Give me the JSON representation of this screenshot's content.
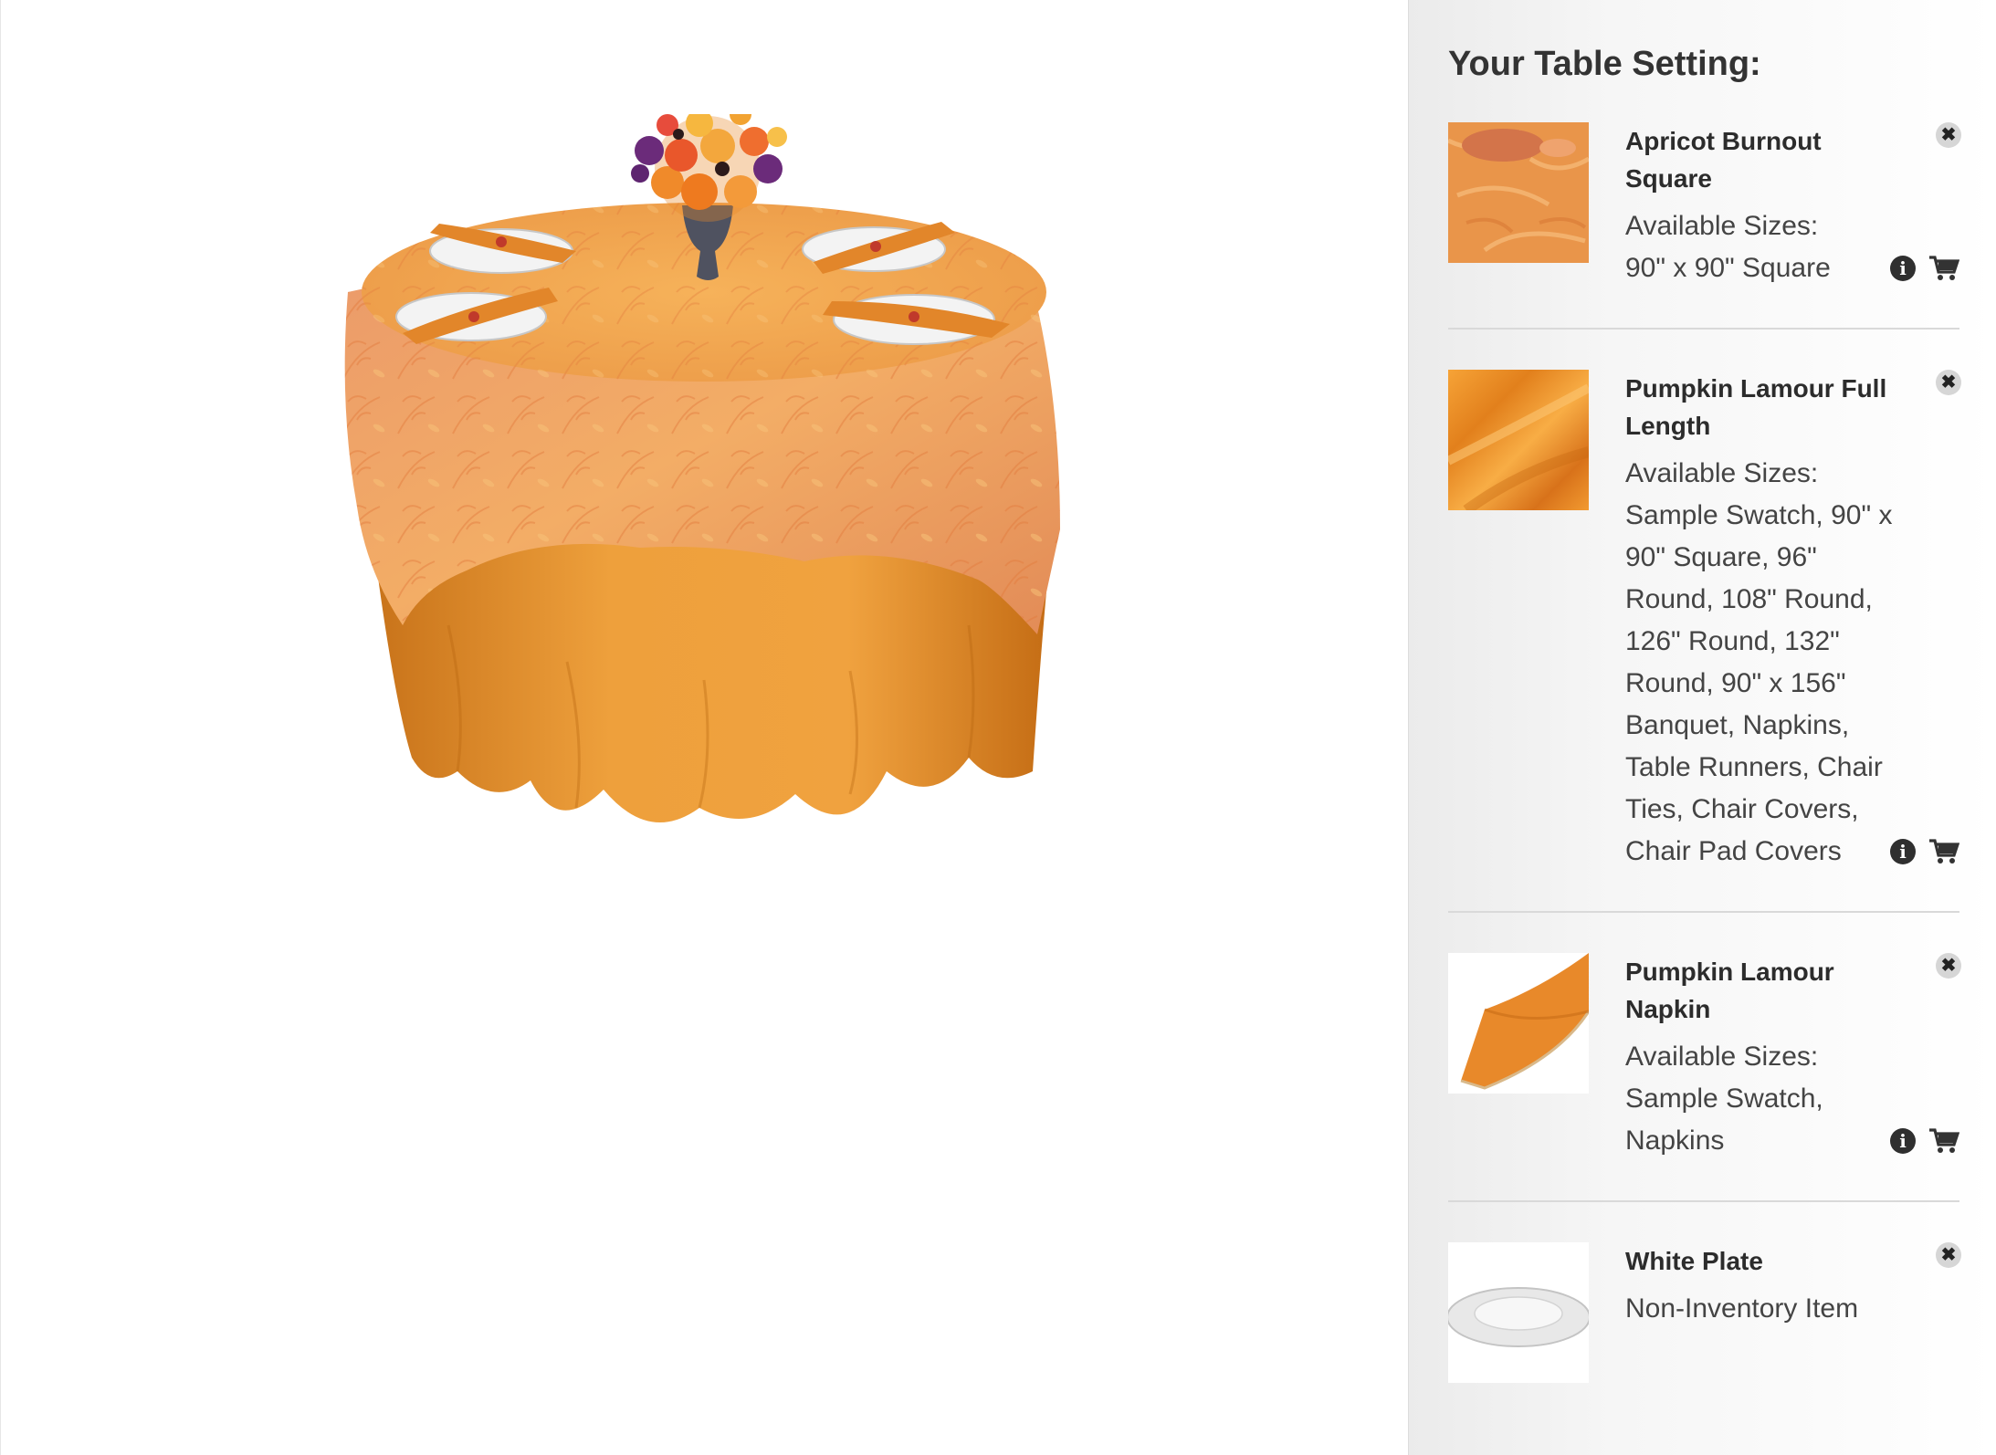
{
  "sidebar": {
    "title": "Your Table Setting:",
    "items": [
      {
        "name": "Apricot Burnout Square",
        "sizes_label": "Available Sizes:",
        "sizes": "90\" x 90\" Square",
        "thumb_icon": "apricot-burnout-swatch"
      },
      {
        "name": "Pumpkin Lamour Full Length",
        "sizes_label": "Available Sizes:",
        "sizes": "Sample Swatch, 90\" x 90\" Square, 96\" Round, 108\" Round, 126\" Round, 132\" Round, 90\" x 156\" Banquet, Napkins, Table Runners, Chair Ties, Chair Covers, Chair Pad Covers",
        "thumb_icon": "pumpkin-lamour-swatch"
      },
      {
        "name": "Pumpkin Lamour Napkin",
        "sizes_label": "Available Sizes:",
        "sizes": "Sample Swatch, Napkins",
        "thumb_icon": "pumpkin-napkin-swatch"
      },
      {
        "name": "White Plate",
        "note": "Non-Inventory Item",
        "thumb_icon": "white-plate"
      }
    ],
    "remove_glyph": "✖",
    "info_glyph": "i"
  },
  "colors": {
    "overlay_orange": "#F2A45A",
    "underlay_orange": "#E8922A",
    "sidebar_bg": "#F2F2F2",
    "text_dark": "#2C2C2C"
  }
}
